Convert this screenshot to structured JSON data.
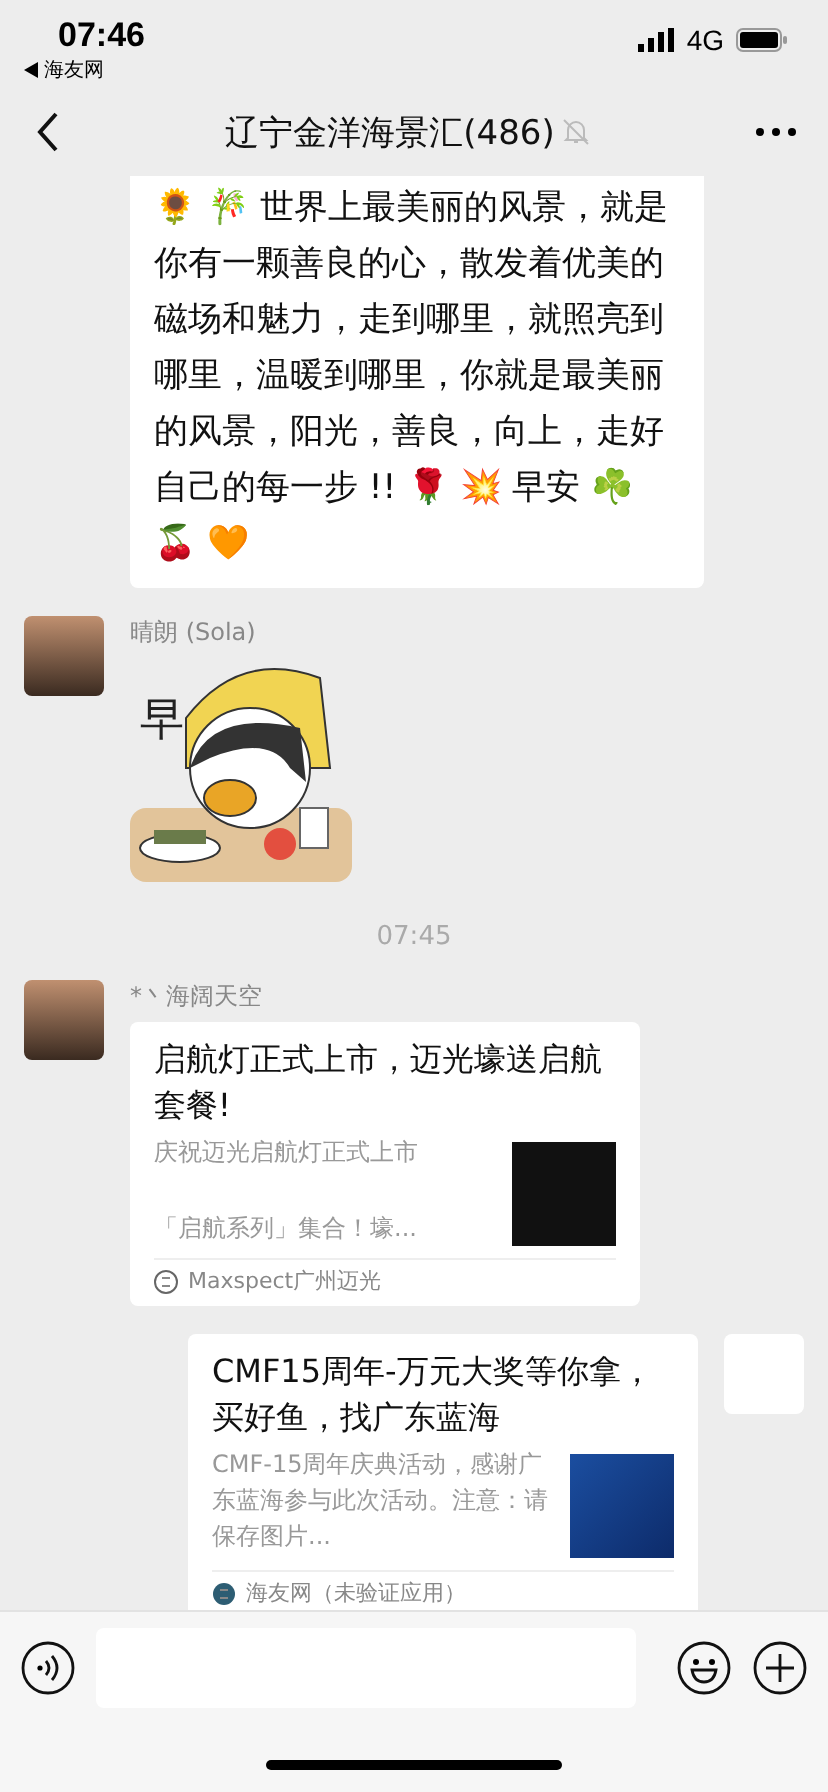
{
  "status_bar": {
    "time": "07:46",
    "back_app": "海友网",
    "network": "4G"
  },
  "nav": {
    "title": "辽宁金洋海景汇(486)",
    "muted": true
  },
  "messages": [
    {
      "kind": "text",
      "outgoing": false,
      "text": "🌻 🎋 世界上最美丽的风景，就是你有一颗善良的心，散发着优美的磁场和魅力，走到哪里，就照亮到哪里，温暖到哪里，你就是最美丽的风景，阳光，善良，向上，走好自己的每一步 !! 🌹 💥 早安 ☘️ 🍒 🧡"
    },
    {
      "kind": "sticker",
      "outgoing": false,
      "sender": "晴朗 (Sola)",
      "caption": "早"
    },
    {
      "kind": "timestamp",
      "text": "07:45"
    },
    {
      "kind": "link_card",
      "outgoing": false,
      "sender": "*丶海阔天空",
      "title": "启航灯正式上市，迈光壕送启航套餐!",
      "summary": [
        "庆祝迈光启航灯正式上市",
        "「启航系列」集合！壕..."
      ],
      "source": "Maxspect广州迈光"
    },
    {
      "kind": "link_card",
      "outgoing": true,
      "title": "CMF15周年-万元大奖等你拿，买好鱼，找广东蓝海",
      "summary": [
        "CMF-15周年庆典活动，感谢广东蓝海参与此次活动。注意：请保存图片..."
      ],
      "source": "海友网（未验证应用）"
    }
  ]
}
